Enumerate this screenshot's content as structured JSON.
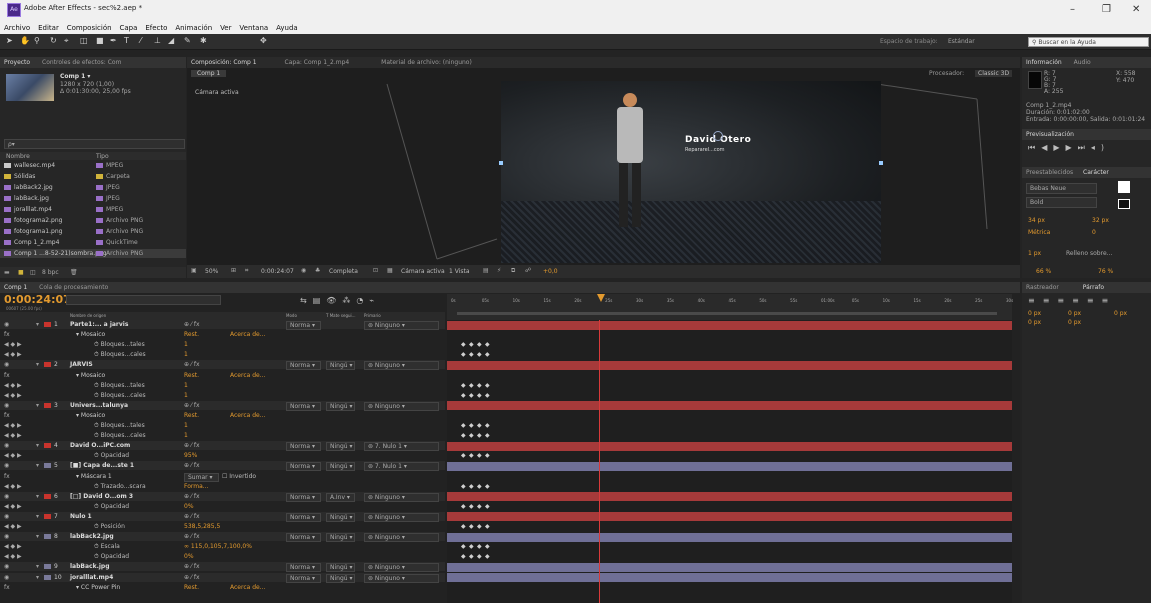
{
  "window": {
    "title": "Adobe After Effects - sec%2.aep *",
    "icon": "ae-icon",
    "controls": [
      "–",
      "❐",
      "✕"
    ]
  },
  "menu": [
    "Archivo",
    "Editar",
    "Composición",
    "Capa",
    "Efecto",
    "Animación",
    "Ver",
    "Ventana",
    "Ayuda"
  ],
  "toolbar": {
    "workspace_label": "Espacio de trabajo:",
    "workspace_value": "Estándar",
    "search_placeholder": "Buscar en la Ayuda"
  },
  "project": {
    "tab_project": "Proyecto",
    "tab_effects": "Controles de efectos: Com",
    "comp_name": "Comp 1 ▾",
    "comp_size": "1280 x 720 (1,00)",
    "comp_duration": "Δ 0:01:30:00, 25,00 fps",
    "search_placeholder": "ρ▾",
    "col_name": "Nombre",
    "col_type": "Tipo",
    "items": [
      {
        "name": "wallesec.mp4",
        "type": "MPEG",
        "color": "#c8c8c8",
        "icon": "video-icon"
      },
      {
        "name": "Sólidas",
        "type": "Carpeta",
        "color": "#d1b43b",
        "icon": "folder-icon"
      },
      {
        "name": "labBack2.jpg",
        "type": "JPEG",
        "color": "#9a70c8",
        "icon": "image-icon"
      },
      {
        "name": "labBack.jpg",
        "type": "JPEG",
        "color": "#9a70c8",
        "icon": "image-icon"
      },
      {
        "name": "joralllat.mp4",
        "type": "MPEG",
        "color": "#9a70c8",
        "icon": "video-icon"
      },
      {
        "name": "fotograma2.png",
        "type": "Archivo PNG",
        "color": "#9a70c8",
        "icon": "image-icon"
      },
      {
        "name": "fotograma1.png",
        "type": "Archivo PNG",
        "color": "#9a70c8",
        "icon": "image-icon"
      },
      {
        "name": "Comp 1_2.mp4",
        "type": "QuickTime",
        "color": "#9a70c8",
        "icon": "video-icon"
      },
      {
        "name": "Comp 1 ...8-52-21)sombra.png",
        "type": "Archivo PNG",
        "color": "#9a70c8",
        "icon": "image-icon"
      }
    ],
    "bpc": "8 bpc"
  },
  "composition": {
    "tab_comp": "Composición: Comp 1",
    "tab_layer": "Capa: Comp 1_2.mp4",
    "tab_footage": "Material de archivo: (ninguno)",
    "comp_chip": "Comp 1",
    "renderer_label": "Procesador:",
    "renderer_value": "Classic 3D",
    "camera": "Cámara activa",
    "overlay_name": "David Otero",
    "overlay_sub": "Repararel...com",
    "zoom": "50%",
    "timecode": "0:00:24:07",
    "resolution": "Completa",
    "view_camera": "Cámara activa",
    "view_count": "1 Vista",
    "exposure": "+0,0"
  },
  "right_panels": {
    "info_tab": "Información",
    "audio_tab": "Audio",
    "rgb": [
      "R: 7",
      "G: 7",
      "B: 7",
      "A: 255"
    ],
    "xy": [
      "X: 558",
      "Y: 470"
    ],
    "info_name": "Comp 1_2.mp4",
    "info_dur": "Duración: 0:01:02:00",
    "info_inout": "Entrada: 0:00:00:00, Salida: 0:01:01:24",
    "preview_tab": "Previsualización",
    "preset_tab": "Preestablecidos",
    "char_tab": "Carácter",
    "font": "Bebas Neue",
    "style": "Bold",
    "size": "34 px",
    "leading": "32 px",
    "kerning": "Métrica",
    "tracking": "0",
    "stroke": "1 px",
    "stroke_mode": "Relleno sobre...",
    "vscale": "66 %",
    "hscale": "76 %",
    "tracker_tab": "Rastreador",
    "para_tab": "Párrafo",
    "para_vals": [
      "0 px",
      "0 px",
      "0 px",
      "0 px",
      "0 px"
    ]
  },
  "timeline": {
    "tab": "Comp 1",
    "tab2": "Cola de procesamiento",
    "timecode": "0:00:24:07",
    "fps": "00607 (25.00 fps)",
    "headers": {
      "name": "Nombre de origen",
      "mode": "Modo",
      "trkmat": "T Mate segui...",
      "parent": "Primario"
    },
    "ruler": [
      "0s",
      "05s",
      "10s",
      "15s",
      "20s",
      "25s",
      "30s",
      "35s",
      "40s",
      "45s",
      "50s",
      "55s",
      "01:00s",
      "05s",
      "10s",
      "15s",
      "20s",
      "25s",
      "30s"
    ],
    "rows": [
      {
        "num": "1",
        "name": "Parte1:... a jarvis",
        "mode": "Norma",
        "parent": "Ninguno",
        "label": "#c9342d",
        "kind": "layer"
      },
      {
        "name": "Mosaico",
        "reset": "Rest.",
        "about": "Acerca de...",
        "kind": "effect"
      },
      {
        "name": "Bloques...tales",
        "value": "1",
        "kind": "prop"
      },
      {
        "name": "Bloques...cales",
        "value": "1",
        "kind": "prop"
      },
      {
        "num": "2",
        "name": "JARVIS",
        "mode": "Norma",
        "trk": "Ningú",
        "parent": "Ninguno",
        "label": "#c9342d",
        "kind": "layer"
      },
      {
        "name": "Mosaico",
        "reset": "Rest.",
        "about": "Acerca de...",
        "kind": "effect"
      },
      {
        "name": "Bloques...tales",
        "value": "1",
        "kind": "prop"
      },
      {
        "name": "Bloques...cales",
        "value": "1",
        "kind": "prop"
      },
      {
        "num": "3",
        "name": "Univers...talunya",
        "mode": "Norma",
        "trk": "Ningú",
        "parent": "Ninguno",
        "label": "#c9342d",
        "kind": "layer"
      },
      {
        "name": "Mosaico",
        "reset": "Rest.",
        "about": "Acerca de...",
        "kind": "effect"
      },
      {
        "name": "Bloques...tales",
        "value": "1",
        "kind": "prop"
      },
      {
        "name": "Bloques...cales",
        "value": "1",
        "kind": "prop"
      },
      {
        "num": "4",
        "name": "David O...iPC.com",
        "mode": "Norma",
        "trk": "Ningú",
        "parent": "7. Nulo 1",
        "label": "#c9342d",
        "kind": "layer"
      },
      {
        "name": "Opacidad",
        "value": "95%",
        "kind": "prop"
      },
      {
        "num": "5",
        "name": "[■] Capa de...ste 1",
        "mode": "Norma",
        "trk": "Ningú",
        "parent": "7. Nulo 1",
        "label": "#7a7a9a",
        "kind": "layer"
      },
      {
        "name": "Máscara 1",
        "maskmode": "Sumar",
        "inv": "Invertido",
        "kind": "effect"
      },
      {
        "name": "Trazado...scara",
        "value": "Forma...",
        "kind": "prop"
      },
      {
        "num": "6",
        "name": "[□] David O...om 3",
        "mode": "Norma",
        "trk": "A.Inv",
        "parent": "Ninguno",
        "label": "#c9342d",
        "kind": "layer"
      },
      {
        "name": "Opacidad",
        "value": "0%",
        "kind": "prop"
      },
      {
        "num": "7",
        "name": "Nulo 1",
        "mode": "Norma",
        "trk": "Ningú",
        "parent": "Ninguno",
        "label": "#c9342d",
        "kind": "layer"
      },
      {
        "name": "Posición",
        "value": "538,5,285,5",
        "kind": "prop"
      },
      {
        "num": "8",
        "name": "labBack2.jpg",
        "mode": "Norma",
        "trk": "Ningú",
        "parent": "Ninguno",
        "label": "#7a7a9a",
        "kind": "layer"
      },
      {
        "name": "Escala",
        "value": "∞ 115,0,105,7,100,0%",
        "kind": "prop"
      },
      {
        "name": "Opacidad",
        "value": "0%",
        "kind": "prop"
      },
      {
        "num": "9",
        "name": "labBack.jpg",
        "mode": "Norma",
        "trk": "Ningú",
        "parent": "Ninguno",
        "label": "#7a7a9a",
        "kind": "layer"
      },
      {
        "num": "10",
        "name": "joralllat.mp4",
        "mode": "Norma",
        "trk": "Ningú",
        "parent": "Ninguno",
        "label": "#7a7a9a",
        "kind": "layer"
      },
      {
        "name": "CC Power Pin",
        "reset": "Rest.",
        "about": "Acerca de...",
        "kind": "effect"
      }
    ]
  },
  "colors": {
    "accent": "#e39a2e",
    "layer_red": "#a63a3a",
    "layer_purple": "#6f6f96",
    "playhead": "#d93a3a",
    "layer_teal": "#5c8f8a"
  }
}
